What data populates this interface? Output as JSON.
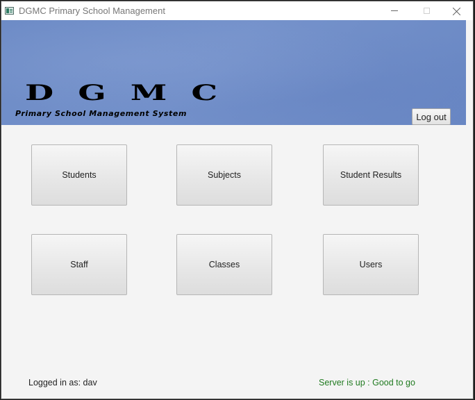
{
  "window": {
    "title": "DGMC Primary School Management",
    "icons": {
      "app": "app-window-icon",
      "minimize": "minimize-icon",
      "maximize": "maximize-icon",
      "close": "close-icon"
    }
  },
  "banner": {
    "logo_title": "DGMC",
    "logo_subtitle": "Primary School Management System",
    "logout_label": "Log out"
  },
  "menu": {
    "tiles": [
      {
        "label": "Students"
      },
      {
        "label": "Subjects"
      },
      {
        "label": "Student Results"
      },
      {
        "label": "Staff"
      },
      {
        "label": "Classes"
      },
      {
        "label": "Users"
      }
    ]
  },
  "status": {
    "logged_in": "Logged in as: dav",
    "server": "Server is up : Good to go",
    "server_color": "#1f7a1f"
  }
}
